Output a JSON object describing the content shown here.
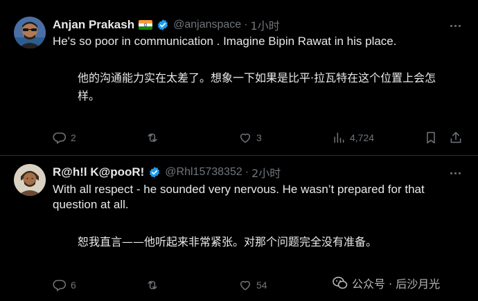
{
  "tweets": [
    {
      "name": "Anjan Prakash",
      "handle": "@anjanspace",
      "separator": "·",
      "time": "1小时",
      "text_en": "He's so poor in communication . Imagine Bipin Rawat in his place.",
      "text_zh": "他的沟通能力实在太差了。想象一下如果是比平·拉瓦特在这个位置上会怎样。",
      "actions": {
        "replies": "2",
        "reposts": "",
        "likes": "3",
        "views": "4,724"
      },
      "has_flag": true
    },
    {
      "name": "R@h!l K@pooR!",
      "handle": "@Rhl15738352",
      "separator": "·",
      "time": "2小时",
      "text_en": "With all respect - he sounded very nervous. He wasn’t prepared for that question at all.",
      "text_zh": "恕我直言——他听起来非常紧张。对那个问题完全没有准备。",
      "actions": {
        "replies": "6",
        "reposts": "",
        "likes": "54",
        "views": ""
      },
      "has_flag": false
    }
  ],
  "watermark": {
    "text": "公众号 · 后沙月光"
  },
  "colors": {
    "background": "#000000",
    "text": "#e7e9ea",
    "muted": "#71767b",
    "verified": "#1d9bf0",
    "divider": "#2f3336"
  },
  "icons": [
    "verified-badge-icon",
    "india-flag-icon",
    "more-icon",
    "reply-icon",
    "repost-icon",
    "like-icon",
    "views-icon",
    "bookmark-icon",
    "share-icon",
    "wechat-icon"
  ]
}
